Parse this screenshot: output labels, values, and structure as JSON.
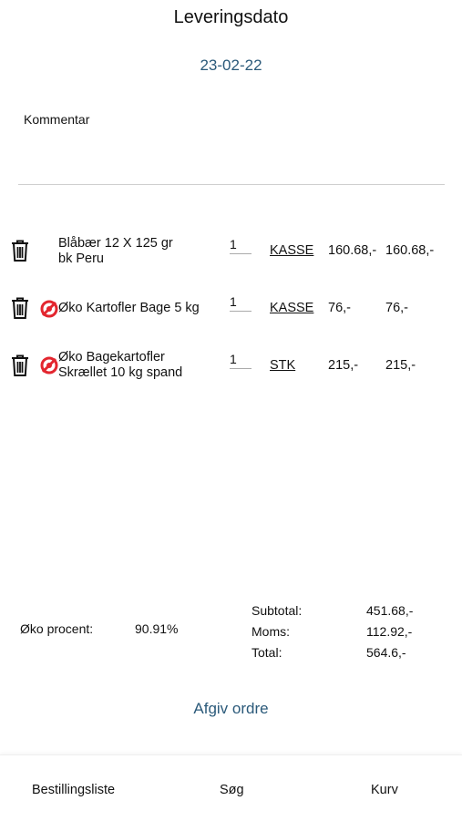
{
  "header": {
    "title": "Leveringsdato",
    "date": "23-02-22"
  },
  "comment": {
    "label": "Kommentar",
    "value": ""
  },
  "items": [
    {
      "name_line1": "Blåbær 12 X 125 gr",
      "name_line2": "bk Peru",
      "eco": false,
      "quantity": "1",
      "unit": "KASSE",
      "price": "160.68,-",
      "total": "160.68,-"
    },
    {
      "name_line1": "Øko Kartofler Bage 5 kg",
      "name_line2": "",
      "eco": true,
      "quantity": "1",
      "unit": "KASSE",
      "price": "76,-",
      "total": "76,-"
    },
    {
      "name_line1": "Øko Bagekartofler",
      "name_line2": "Skrællet 10 kg spand",
      "eco": true,
      "quantity": "1",
      "unit": "STK",
      "price": "215,-",
      "total": "215,-"
    }
  ],
  "summary": {
    "eco_label": "Øko procent:",
    "eco_value": "90.91%",
    "subtotal_label": "Subtotal:",
    "subtotal_value": "451.68,-",
    "moms_label": "Moms:",
    "moms_value": "112.92,-",
    "total_label": "Total:",
    "total_value": "564.6,-"
  },
  "actions": {
    "place_order": "Afgiv ordre"
  },
  "bottom_nav": {
    "order_list": "Bestillingsliste",
    "search": "Søg",
    "cart": "Kurv"
  },
  "icons": {
    "trash": "trash-icon",
    "eco": "organic-label-icon"
  },
  "colors": {
    "accent": "#2b5a7a",
    "eco_red": "#e3262f"
  }
}
